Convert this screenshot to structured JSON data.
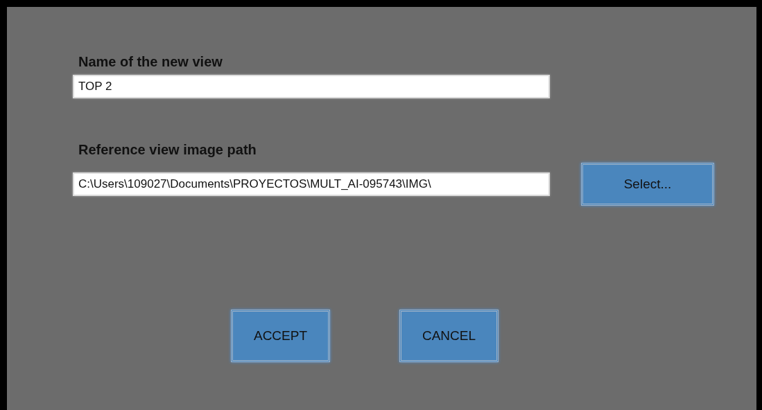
{
  "fields": [
    {
      "label": "Name of the new view",
      "value": "TOP 2"
    },
    {
      "label": "Reference view image path",
      "value": "C:\\Users\\109027\\Documents\\PROYECTOS\\MULT_AI-095743\\IMG\\",
      "button": "Select..."
    }
  ],
  "buttons": [
    "ACCEPT",
    "CANCEL"
  ]
}
